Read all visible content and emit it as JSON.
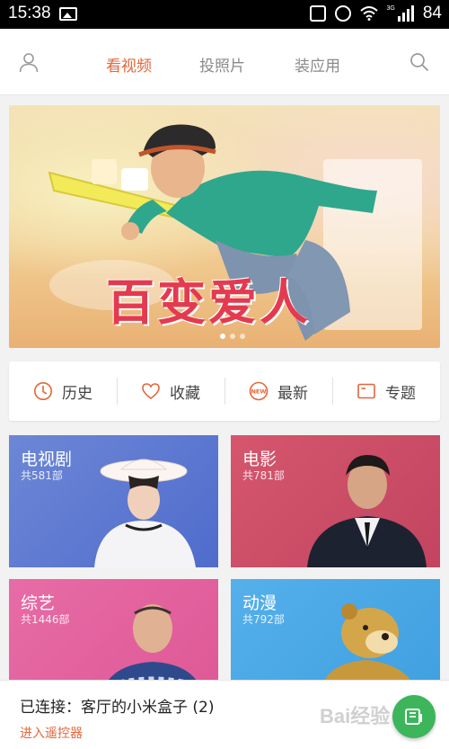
{
  "status_bar": {
    "time": "15:38",
    "network": "3G",
    "battery": "84"
  },
  "top_nav": {
    "tabs": [
      {
        "label": "看视频",
        "active": true
      },
      {
        "label": "投照片",
        "active": false
      },
      {
        "label": "装应用",
        "active": false
      }
    ],
    "user_icon": "user-icon",
    "search_icon": "search-icon"
  },
  "banner": {
    "title": "百变爱人",
    "slide_index": 1,
    "slide_count": 3
  },
  "quick_links": [
    {
      "label": "历史",
      "icon": "clock-icon"
    },
    {
      "label": "收藏",
      "icon": "heart-icon"
    },
    {
      "label": "最新",
      "icon": "new-badge-icon"
    },
    {
      "label": "专题",
      "icon": "folder-icon"
    }
  ],
  "categories": [
    {
      "title": "电视剧",
      "count": "共581部",
      "color": "#5b78d1"
    },
    {
      "title": "电影",
      "count": "共781部",
      "color": "#c84b64"
    },
    {
      "title": "综艺",
      "count": "共1446部",
      "color": "#e2609d"
    },
    {
      "title": "动漫",
      "count": "共792部",
      "color": "#49a7e6"
    }
  ],
  "connection": {
    "status": "已连接：客厅的小米盒子 (2)",
    "action": "进入遥控器"
  },
  "watermark": "Bai经验",
  "colors": {
    "accent": "#e4663a",
    "fab": "#3cb55b"
  }
}
